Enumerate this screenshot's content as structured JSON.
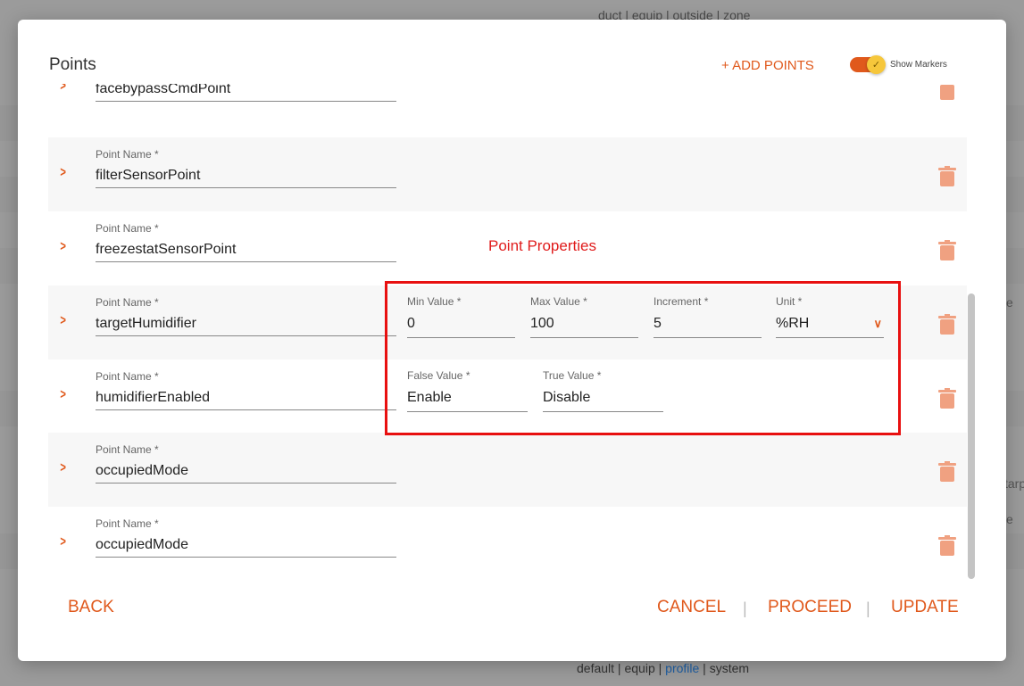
{
  "background": {
    "top_breadcrumb": "duct | equip | outside | zone",
    "bottom_tags": [
      "default",
      "equip",
      "profile",
      "system"
    ],
    "bottom_active": "profile",
    "side_fragments": [
      "e",
      "tarp",
      "e"
    ]
  },
  "modal": {
    "title": "Points",
    "add_points_label": "+ ADD POINTS",
    "show_markers_label": "Show Markers",
    "show_markers_on": true,
    "accent_color": "#e0591c"
  },
  "points": [
    {
      "label": "",
      "value": "facebypassCmdPoint"
    },
    {
      "label": "Point Name *",
      "value": "filterSensorPoint"
    },
    {
      "label": "Point Name *",
      "value": "freezestatSensorPoint"
    },
    {
      "label": "Point Name *",
      "value": "targetHumidifier"
    },
    {
      "label": "Point Name *",
      "value": "humidifierEnabled"
    },
    {
      "label": "Point Name *",
      "value": "occupiedMode"
    },
    {
      "label": "Point Name *",
      "value": "occupiedMode"
    }
  ],
  "point_properties": {
    "title": "Point Properties",
    "min": {
      "label": "Min Value *",
      "value": "0"
    },
    "max": {
      "label": "Max Value *",
      "value": "100"
    },
    "increment": {
      "label": "Increment *",
      "value": "5"
    },
    "unit": {
      "label": "Unit *",
      "value": "%RH"
    },
    "false_value": {
      "label": "False Value *",
      "value": "Enable"
    },
    "true_value": {
      "label": "True Value *",
      "value": "Disable"
    }
  },
  "footer": {
    "back": "BACK",
    "cancel": "CANCEL",
    "separator": "|",
    "proceed": "PROCEED",
    "update": "UPDATE"
  }
}
